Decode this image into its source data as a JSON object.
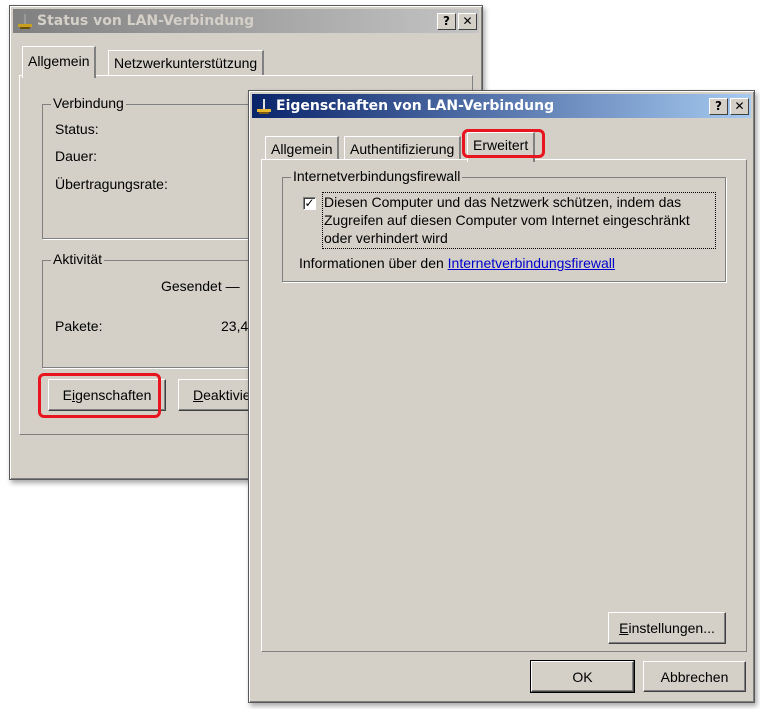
{
  "back_window": {
    "title": "Status von LAN-Verbindung",
    "help_btn": "?",
    "close_btn": "✕",
    "tabs": [
      "Allgemein",
      "Netzwerkunterstützung"
    ],
    "connection_group": {
      "legend": "Verbindung",
      "rows": [
        "Status:",
        "Dauer:",
        "Übertragungsrate:"
      ]
    },
    "activity_group": {
      "legend": "Aktivität",
      "sent_label": "Gesendet —",
      "packets_label": "Pakete:",
      "packets_value": "23,4"
    },
    "buttons": {
      "properties": {
        "pre": "E",
        "acc": "i",
        "post": "genschaften"
      },
      "deactivate": {
        "pre": "",
        "acc": "D",
        "post": "eaktivier"
      }
    }
  },
  "front_window": {
    "title": "Eigenschaften von LAN-Verbindung",
    "help_btn": "?",
    "close_btn": "✕",
    "tabs": [
      "Allgemein",
      "Authentifizierung",
      "Erweitert"
    ],
    "selected_tab": "Erweitert",
    "firewall_group": {
      "legend": "Internetverbindungsfirewall",
      "checkbox_checked": true,
      "checkbox_mark": "✓",
      "checkbox_lines": [
        "Diesen Computer und das Netzwerk schützen, indem das",
        "Zugreifen auf diesen Computer vom Internet eingeschränkt",
        "oder verhindert wird"
      ],
      "info_prefix": "Informationen über den ",
      "info_link": "Internetverbindungsfirewall"
    },
    "buttons": {
      "settings": {
        "pre": "",
        "acc": "E",
        "post": "instellungen..."
      },
      "ok": "OK",
      "cancel": "Abbrechen"
    }
  },
  "colors": {
    "highlight": "#e8141e",
    "dialog_bg": "#d4d0c8",
    "active_title": "#0a246a",
    "link": "#0000cc"
  }
}
